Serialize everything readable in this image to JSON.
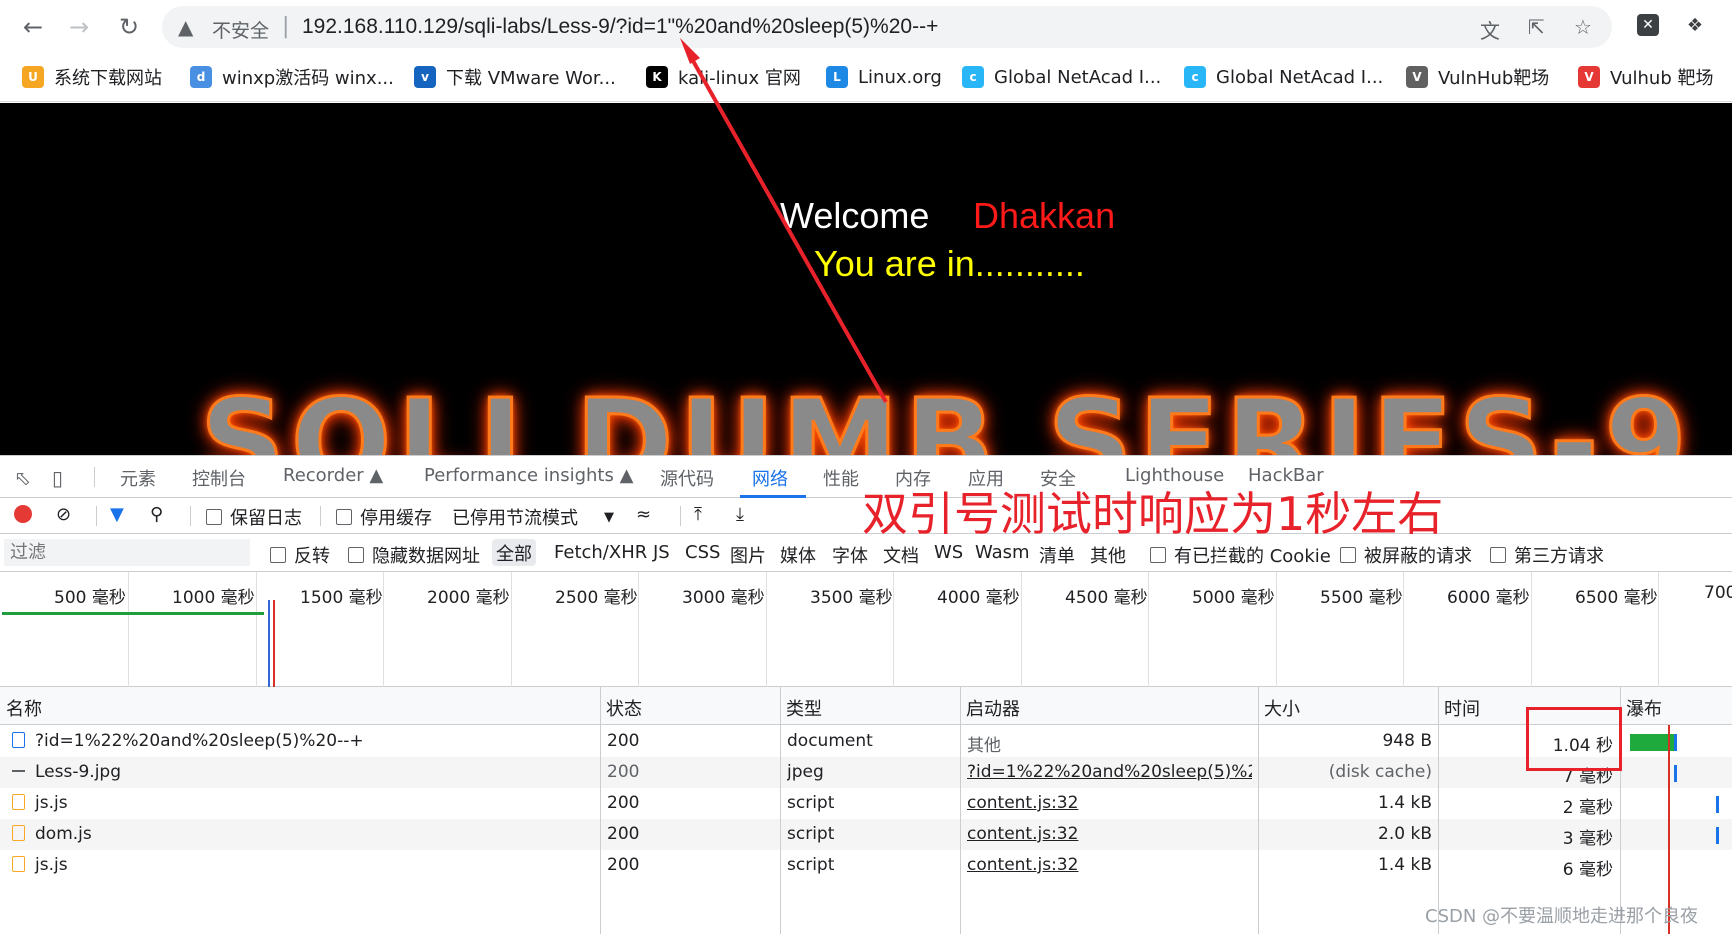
{
  "browser": {
    "insecure_label": "不安全",
    "url": "192.168.110.129/sqli-labs/Less-9/?id=1\"%20and%20sleep(5)%20--+"
  },
  "bookmarks": [
    {
      "label": "系统下载网站",
      "color": "#f5a623"
    },
    {
      "label": "winxp激活码 winx...",
      "color": "#4a90e2"
    },
    {
      "label": "下载 VMware Wor...",
      "color": "#1565c0"
    },
    {
      "label": "kali-linux 官网",
      "color": "#000000"
    },
    {
      "label": "Linux.org",
      "color": "#1e88e5"
    },
    {
      "label": "Global NetAcad I...",
      "color": "#29b6f6"
    },
    {
      "label": "Global NetAcad I...",
      "color": "#29b6f6"
    },
    {
      "label": "VulnHub靶场",
      "color": "#616161"
    },
    {
      "label": "Vulhub 靶场",
      "color": "#e53935"
    }
  ],
  "page": {
    "welcome": "Welcome",
    "name": "Dhakkan",
    "status": "You are in...........",
    "banner": "SQLI DUMB SERIES-9"
  },
  "devtools": {
    "tabs": [
      "元素",
      "控制台",
      "Recorder",
      "Performance insights",
      "源代码",
      "网络",
      "性能",
      "内存",
      "应用",
      "安全",
      "Lighthouse",
      "HackBar"
    ],
    "active_tab": "网络",
    "toolbar": {
      "preserve_log": "保留日志",
      "disable_cache": "停用缓存",
      "throttle": "已停用节流模式"
    },
    "filter": {
      "placeholder": "过滤",
      "invert": "反转",
      "hide_data_urls": "隐藏数据网址",
      "types": [
        "全部",
        "Fetch/XHR",
        "JS",
        "CSS",
        "图片",
        "媒体",
        "字体",
        "文档",
        "WS",
        "Wasm",
        "清单",
        "其他"
      ],
      "blocked_cookies": "有已拦截的 Cookie",
      "blocked_requests": "被屏蔽的请求",
      "third_party": "第三方请求"
    },
    "overview_ticks": [
      "500 毫秒",
      "1000 毫秒",
      "1500 毫秒",
      "2000 毫秒",
      "2500 毫秒",
      "3000 毫秒",
      "3500 毫秒",
      "4000 毫秒",
      "4500 毫秒",
      "5000 毫秒",
      "5500 毫秒",
      "6000 毫秒",
      "6500 毫秒",
      "700"
    ],
    "columns": [
      "名称",
      "状态",
      "类型",
      "启动器",
      "大小",
      "时间",
      "瀑布"
    ],
    "rows": [
      {
        "name": "?id=1%22%20and%20sleep(5)%20--+",
        "status": "200",
        "type": "document",
        "initiator": "其他",
        "size": "948 B",
        "time": "1.04 秒",
        "icon_color": "#1a73e8"
      },
      {
        "name": "Less-9.jpg",
        "status": "200",
        "type": "jpeg",
        "initiator": "?id=1%22%20and%20sleep(5)%2...",
        "size": "(disk cache)",
        "time": "7 毫秒",
        "icon_color": "#5f6368"
      },
      {
        "name": "js.js",
        "status": "200",
        "type": "script",
        "initiator": "content.js:32",
        "size": "1.4 kB",
        "time": "2 毫秒",
        "icon_color": "#f9a825"
      },
      {
        "name": "dom.js",
        "status": "200",
        "type": "script",
        "initiator": "content.js:32",
        "size": "2.0 kB",
        "time": "3 毫秒",
        "icon_color": "#f9a825"
      },
      {
        "name": "js.js",
        "status": "200",
        "type": "script",
        "initiator": "content.js:32",
        "size": "1.4 kB",
        "time": "6 毫秒",
        "icon_color": "#f9a825"
      }
    ]
  },
  "annotation": {
    "text": "双引号测试时响应为1秒左右",
    "color": "#e8222b"
  },
  "watermark": "CSDN @不要温顺地走进那个良夜"
}
